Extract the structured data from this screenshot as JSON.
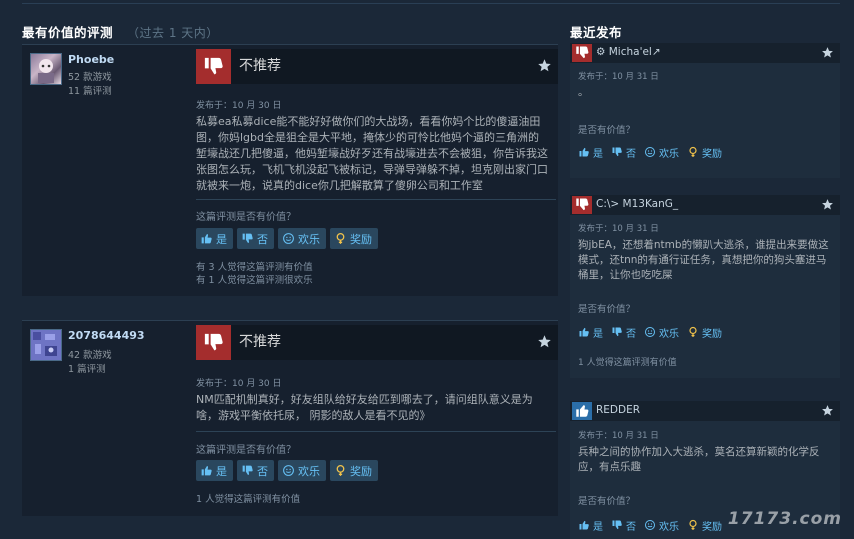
{
  "left_section": {
    "title": "最有价值的评测",
    "subtitle": "（过去 1 天内）"
  },
  "right_section": {
    "title": "最近发布"
  },
  "reviews": [
    {
      "author_name": "Phoebe",
      "games_owned": "52 款游戏",
      "reviews_count": "11 篇评测",
      "verdict": "不推荐",
      "posted": "发布于：10 月 30 日",
      "text": "私募ea私募dice能不能好好做你们的大战场，看看你妈个比的傻逼油田图，你妈lgbd全是狙全是大平地，掩体少的可怜比他妈个逼的三角洲的堑壕战还几把傻逼，他妈堑壕战好歹还有战壕进去不会被狙，你告诉我这张图怎么玩，飞机飞机没起飞被标记，导弹导弹躲不掉，坦克刚出家门口就被来一炮，说真的dice你几把解散算了傻卵公司和工作室",
      "helpful_question": "这篇评测是否有价值？",
      "buttons": {
        "yes": "是",
        "no": "否",
        "funny": "欢乐",
        "award": "奖励"
      },
      "stat1": "有 3 人觉得这篇评测有价值",
      "stat2": "有 1 人觉得这篇评测很欢乐"
    },
    {
      "author_name": "2078644493",
      "games_owned": "42 款游戏",
      "reviews_count": "1 篇评测",
      "verdict": "不推荐",
      "posted": "发布于：10 月 30 日",
      "text": "NM匹配机制真好，好友组队给好友给匹到哪去了，请问组队意义是为啥，游戏平衡依托尿， 阴影的敌人是看不见的》",
      "helpful_question": "这篇评测是否有价值？",
      "buttons": {
        "yes": "是",
        "no": "否",
        "funny": "欢乐",
        "award": "奖励"
      },
      "stat1": "1 人觉得这篇评测有价值"
    }
  ],
  "recent": [
    {
      "author_name": "⚙ Micha'el↗",
      "posted": "发布于：10 月 31 日",
      "text": "。",
      "helpful_question": "是否有价值？",
      "buttons": {
        "yes": "是",
        "no": "否",
        "funny": "欢乐",
        "award": "奖励"
      }
    },
    {
      "author_name": "C:\\> M13KanG_",
      "posted": "发布于：10 月 31 日",
      "text": "狗jbEA，还想着ntmb的懒趴大逃杀，谁提出来要做这模式，还tnn的有通行证任务，真想把你的狗头塞进马桶里，让你也吃吃屎",
      "helpful_question": "是否有价值？",
      "buttons": {
        "yes": "是",
        "no": "否",
        "funny": "欢乐",
        "award": "奖励"
      },
      "stat": "1 人觉得这篇评测有价值"
    },
    {
      "author_name": "REDDER",
      "posted": "发布于：10 月 31 日",
      "text": "兵种之间的协作加入大逃杀，莫名还算新颖的化学反应，有点乐趣",
      "helpful_question": "是否有价值？",
      "buttons": {
        "yes": "是",
        "no": "否",
        "funny": "欢乐",
        "award": "奖励"
      }
    }
  ],
  "watermark": "17173.com",
  "colors": {
    "not_recommended": "#a42d2d",
    "recommended": "#2b6ea8",
    "link": "#66c0f4",
    "background": "#1b2838"
  }
}
